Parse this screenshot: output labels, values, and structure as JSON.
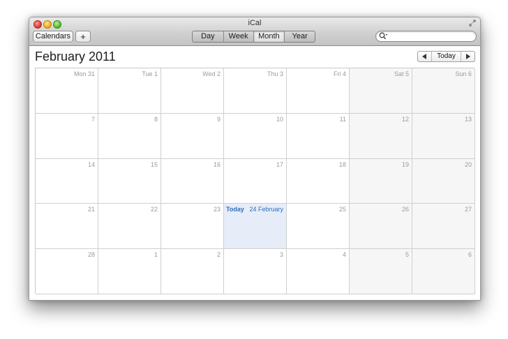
{
  "window": {
    "title": "iCal"
  },
  "toolbar": {
    "calendars_label": "Calendars",
    "add_label": "+",
    "views": [
      {
        "label": "Day",
        "selected": false
      },
      {
        "label": "Week",
        "selected": false
      },
      {
        "label": "Month",
        "selected": true
      },
      {
        "label": "Year",
        "selected": false
      }
    ],
    "search": {
      "value": "",
      "placeholder": ""
    }
  },
  "header": {
    "month_title": "February 2011",
    "today_button": "Today"
  },
  "calendar": {
    "today_label": "Today",
    "rows": [
      [
        {
          "label": "Mon 31",
          "weekend": false
        },
        {
          "label": "Tue 1",
          "weekend": false
        },
        {
          "label": "Wed 2",
          "weekend": false
        },
        {
          "label": "Thu 3",
          "weekend": false
        },
        {
          "label": "Fri 4",
          "weekend": false
        },
        {
          "label": "Sat 5",
          "weekend": true
        },
        {
          "label": "Sun 6",
          "weekend": true
        }
      ],
      [
        {
          "label": "7",
          "weekend": false
        },
        {
          "label": "8",
          "weekend": false
        },
        {
          "label": "9",
          "weekend": false
        },
        {
          "label": "10",
          "weekend": false
        },
        {
          "label": "11",
          "weekend": false
        },
        {
          "label": "12",
          "weekend": true
        },
        {
          "label": "13",
          "weekend": true
        }
      ],
      [
        {
          "label": "14",
          "weekend": false
        },
        {
          "label": "15",
          "weekend": false
        },
        {
          "label": "16",
          "weekend": false
        },
        {
          "label": "17",
          "weekend": false
        },
        {
          "label": "18",
          "weekend": false
        },
        {
          "label": "19",
          "weekend": true
        },
        {
          "label": "20",
          "weekend": true
        }
      ],
      [
        {
          "label": "21",
          "weekend": false
        },
        {
          "label": "22",
          "weekend": false
        },
        {
          "label": "23",
          "weekend": false
        },
        {
          "label": "24 February",
          "weekend": false,
          "today": true
        },
        {
          "label": "25",
          "weekend": false
        },
        {
          "label": "26",
          "weekend": true
        },
        {
          "label": "27",
          "weekend": true
        }
      ],
      [
        {
          "label": "28",
          "weekend": false
        },
        {
          "label": "1",
          "weekend": false
        },
        {
          "label": "2",
          "weekend": false
        },
        {
          "label": "3",
          "weekend": false
        },
        {
          "label": "4",
          "weekend": false
        },
        {
          "label": "5",
          "weekend": true
        },
        {
          "label": "6",
          "weekend": true
        }
      ]
    ]
  },
  "colors": {
    "today_accent": "#2f6dbb",
    "today_fill": "#e6edf8",
    "weekend_fill": "#f6f6f6"
  },
  "icons": [
    "close-icon",
    "minimize-icon",
    "zoom-icon",
    "fullscreen-icon",
    "search-icon",
    "chevron-left-icon",
    "chevron-right-icon"
  ]
}
